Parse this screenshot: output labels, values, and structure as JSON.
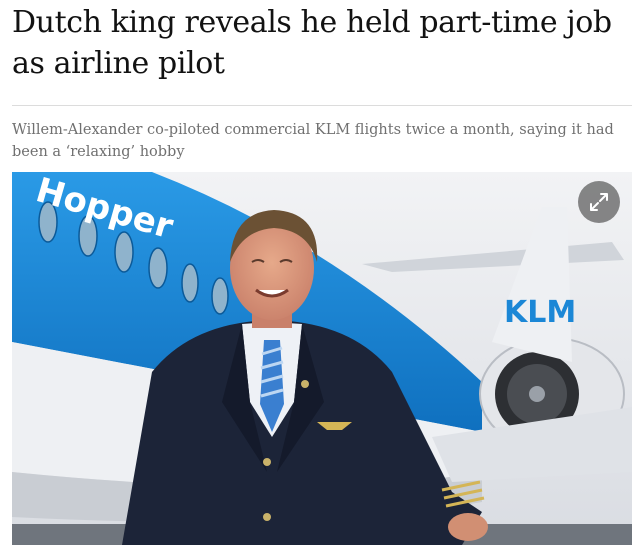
{
  "article": {
    "headline": "Dutch king reveals he held part-time job as airline pilot",
    "standfirst": "Willem-Alexander co-piloted commercial KLM flights twice a month, saying it had been a ‘relaxing’ hobby"
  },
  "photo": {
    "fuselage_text": "Hopper",
    "tail_logo": "KLM",
    "expand_icon": "expand-arrows-icon"
  },
  "colors": {
    "headline": "#121212",
    "standfirst": "#707070",
    "klm_blue": "#1b87d6",
    "uniform": "#1c2438"
  }
}
